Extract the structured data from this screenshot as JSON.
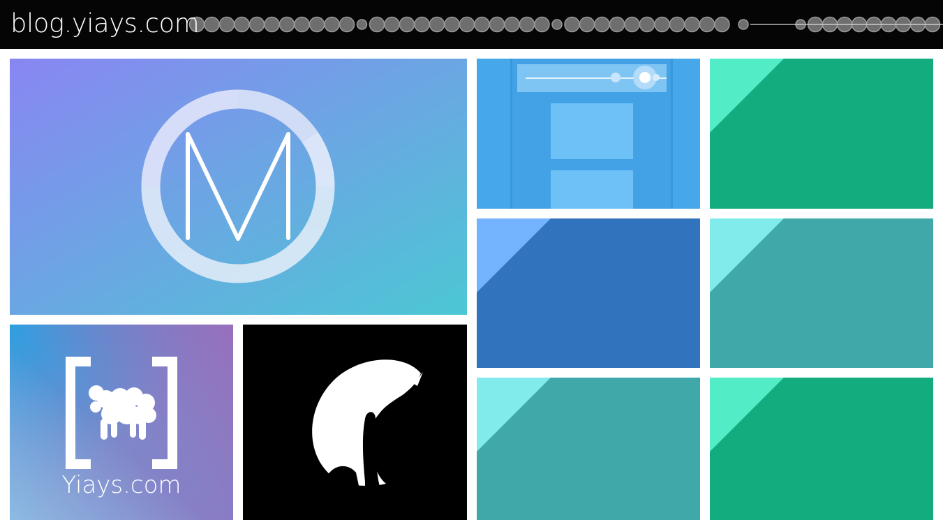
{
  "header": {
    "title": "blog.yiays.com",
    "background_color": "#050505",
    "decoration": "loading-dots-line"
  },
  "tiles": [
    {
      "id": "tile-m-logo",
      "icon": "m-ring-logo",
      "gradient": [
        "#8986f2",
        "#4cc7d4"
      ]
    },
    {
      "id": "tile-yiays",
      "icon": "sheep-brackets-logo",
      "label": "Yiays.com",
      "gradient": [
        "#3ba0e0",
        "#9a6fba"
      ]
    },
    {
      "id": "tile-moon",
      "icon": "moon-silhouette",
      "color": "#000000"
    },
    {
      "id": "tile-phone-ui",
      "icon": "app-mockup",
      "color": "#46a7ea"
    },
    {
      "id": "tile-green-1",
      "color": "#12ac7f",
      "accent": "#52edc6"
    },
    {
      "id": "tile-blue",
      "color": "#3273be",
      "accent": "#74b3fe"
    },
    {
      "id": "tile-teal-1",
      "color": "#41a8a9",
      "accent": "#81ebeb"
    },
    {
      "id": "tile-teal-2",
      "color": "#41a8a9",
      "accent": "#81ebeb"
    },
    {
      "id": "tile-green-2",
      "color": "#12ac7f",
      "accent": "#52edc6"
    }
  ]
}
